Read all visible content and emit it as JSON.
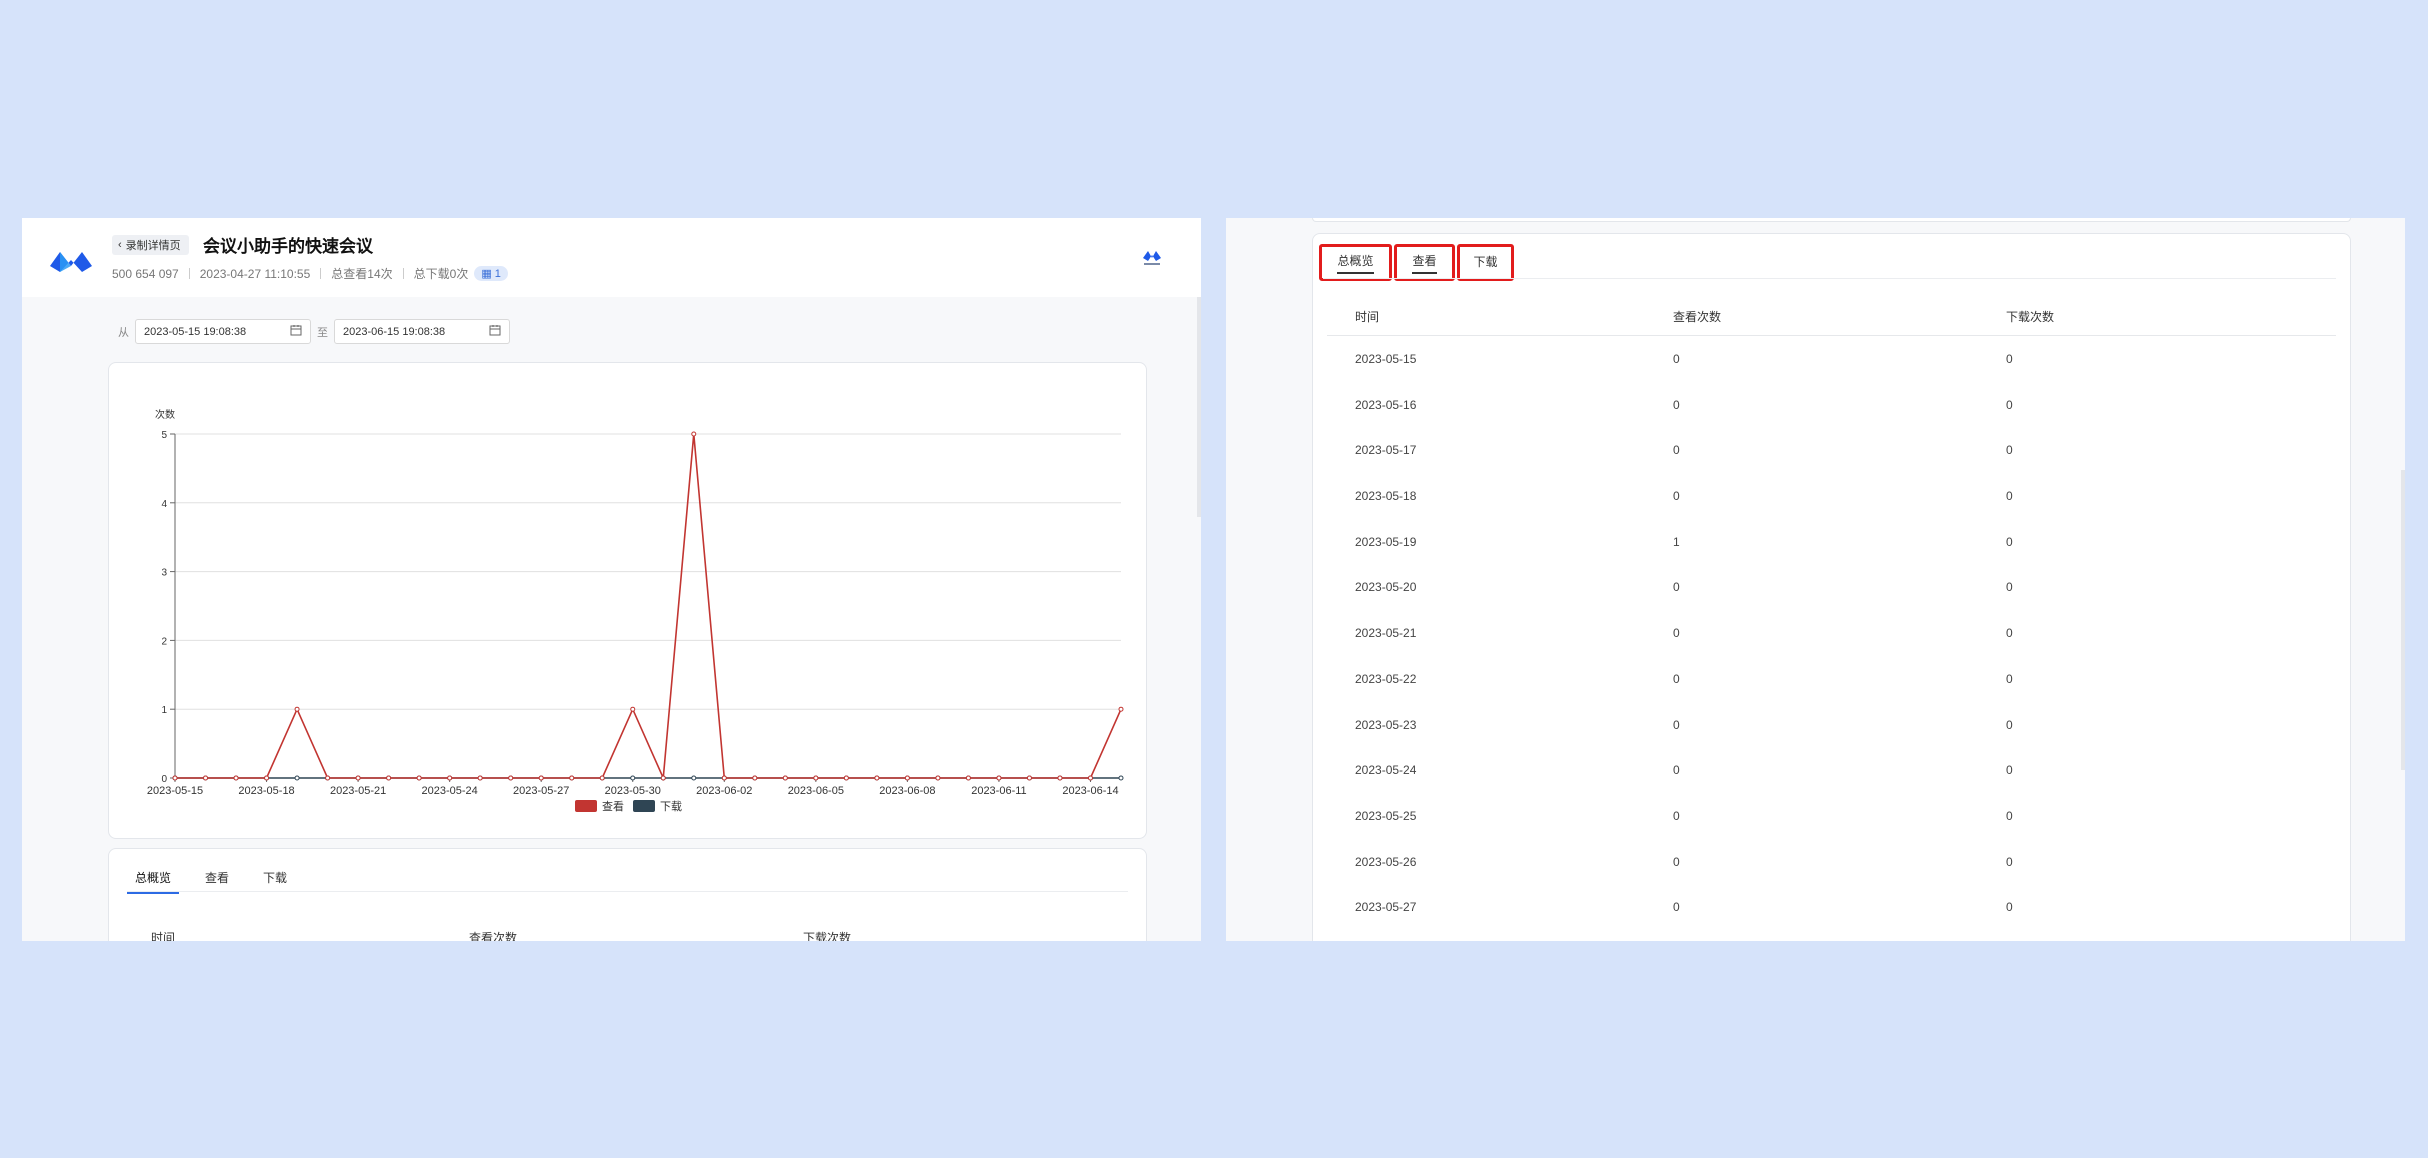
{
  "header": {
    "back_label": "录制详情页",
    "title": "会议小助手的快速会议",
    "meeting_id": "500 654 097",
    "datetime": "2023-04-27 11:10:55",
    "total_views": "总查看14次",
    "total_downloads": "总下载0次",
    "badge_count": "1"
  },
  "filters": {
    "from_label": "从",
    "to_label": "至",
    "from_value": "2023-05-15 19:08:38",
    "to_value": "2023-06-15 19:08:38"
  },
  "chart_data": {
    "type": "line",
    "ylabel": "次数",
    "ylim": [
      0,
      5
    ],
    "yticks": [
      0,
      1,
      2,
      3,
      4,
      5
    ],
    "x": [
      "2023-05-15",
      "2023-05-16",
      "2023-05-17",
      "2023-05-18",
      "2023-05-19",
      "2023-05-20",
      "2023-05-21",
      "2023-05-22",
      "2023-05-23",
      "2023-05-24",
      "2023-05-25",
      "2023-05-26",
      "2023-05-27",
      "2023-05-28",
      "2023-05-29",
      "2023-05-30",
      "2023-05-31",
      "2023-06-01",
      "2023-06-02",
      "2023-06-03",
      "2023-06-04",
      "2023-06-05",
      "2023-06-06",
      "2023-06-07",
      "2023-06-08",
      "2023-06-09",
      "2023-06-10",
      "2023-06-11",
      "2023-06-12",
      "2023-06-13",
      "2023-06-14",
      "2023-06-15"
    ],
    "xtick_labels": [
      "2023-05-15",
      "2023-05-18",
      "2023-05-21",
      "2023-05-24",
      "2023-05-27",
      "2023-05-30",
      "2023-06-02",
      "2023-06-05",
      "2023-06-08",
      "2023-06-11",
      "2023-06-14"
    ],
    "series": [
      {
        "name": "查看",
        "color": "#c23531",
        "values": [
          0,
          0,
          0,
          0,
          1,
          0,
          0,
          0,
          0,
          0,
          0,
          0,
          0,
          0,
          0,
          1,
          0,
          5,
          0,
          0,
          0,
          0,
          0,
          0,
          0,
          0,
          0,
          0,
          0,
          0,
          0,
          1
        ]
      },
      {
        "name": "下载",
        "color": "#2f4554",
        "values": [
          0,
          0,
          0,
          0,
          0,
          0,
          0,
          0,
          0,
          0,
          0,
          0,
          0,
          0,
          0,
          0,
          0,
          0,
          0,
          0,
          0,
          0,
          0,
          0,
          0,
          0,
          0,
          0,
          0,
          0,
          0,
          0
        ]
      }
    ],
    "legend_position": "bottom-center",
    "grid": true
  },
  "left_tabs": [
    "总概览",
    "查看",
    "下载"
  ],
  "right_tabs": [
    "总概览",
    "查看",
    "下载"
  ],
  "table": {
    "columns": [
      "时间",
      "查看次数",
      "下载次数"
    ],
    "rows": [
      [
        "2023-05-15",
        "0",
        "0"
      ],
      [
        "2023-05-16",
        "0",
        "0"
      ],
      [
        "2023-05-17",
        "0",
        "0"
      ],
      [
        "2023-05-18",
        "0",
        "0"
      ],
      [
        "2023-05-19",
        "1",
        "0"
      ],
      [
        "2023-05-20",
        "0",
        "0"
      ],
      [
        "2023-05-21",
        "0",
        "0"
      ],
      [
        "2023-05-22",
        "0",
        "0"
      ],
      [
        "2023-05-23",
        "0",
        "0"
      ],
      [
        "2023-05-24",
        "0",
        "0"
      ],
      [
        "2023-05-25",
        "0",
        "0"
      ],
      [
        "2023-05-26",
        "0",
        "0"
      ],
      [
        "2023-05-27",
        "0",
        "0"
      ]
    ]
  },
  "colors": {
    "background": "#d6e3fa",
    "accent": "#2d6be4",
    "highlight_border": "#e21c1c"
  }
}
